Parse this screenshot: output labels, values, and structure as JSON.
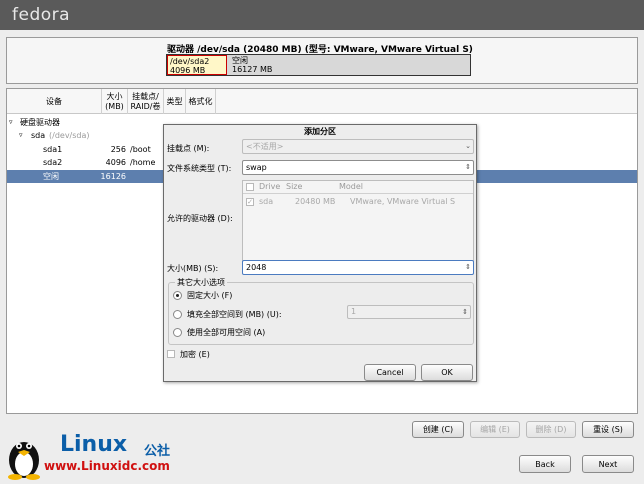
{
  "brand": {
    "logo_text": "fedora"
  },
  "drive": {
    "title": "驱动器 /dev/sda (20480 MB) (型号: VMware, VMware Virtual S)",
    "segments": [
      {
        "label": "/dev/sda2",
        "size": "4096 MB",
        "color": "#fff7c8"
      },
      {
        "label": "空闲",
        "size": "16127 MB"
      }
    ]
  },
  "table": {
    "headers": [
      "设备",
      "大小\n(MB)",
      "挂载点/\nRAID/卷",
      "类型",
      "格式化"
    ],
    "rows": [
      {
        "device": "硬盘驱动器",
        "size": "",
        "mount": "",
        "level": 0,
        "expander": "▿"
      },
      {
        "device": "sda",
        "device_path": "(/dev/sda)",
        "size": "",
        "mount": "",
        "level": 1,
        "expander": "▿"
      },
      {
        "device": "sda1",
        "size": "256",
        "mount": "/boot",
        "level": 2
      },
      {
        "device": "sda2",
        "size": "4096",
        "mount": "/home",
        "level": 2
      },
      {
        "device": "空闲",
        "size": "16126",
        "mount": "",
        "level": 2,
        "selected": true
      }
    ]
  },
  "dialog": {
    "title": "添加分区",
    "mount_label": "挂载点 (M):",
    "mount_value": "<不适用>",
    "fs_label": "文件系统类型 (T):",
    "fs_value": "swap",
    "drives_label": "允许的驱动器 (D):",
    "drive_columns": [
      "Drive",
      "Size",
      "Model"
    ],
    "drive_rows": [
      {
        "checked": true,
        "drive": "sda",
        "size": "20480 MB",
        "model": "VMware, VMware Virtual S"
      }
    ],
    "size_label": "大小(MB) (S):",
    "size_value": "2048",
    "options_title": "其它大小选项",
    "opt_fixed": "固定大小 (F)",
    "opt_fill_to": "填充全部空间到 (MB) (U):",
    "opt_fill_value": "1",
    "opt_fill_all": "使用全部可用空间 (A)",
    "selected_option": "fixed",
    "encrypt_label": "加密 (E)",
    "cancel_label": "Cancel",
    "ok_label": "OK"
  },
  "actions": {
    "create": "创建 (C)",
    "edit": "编辑 (E)",
    "delete": "删除 (D)",
    "reset": "重设 (S)"
  },
  "nav": {
    "back": "Back",
    "next": "Next"
  },
  "watermark": {
    "brand": "Linux",
    "suffix": "公社",
    "url": "www.Linuxidc.com"
  },
  "colors": {
    "selection": "#5d7fae",
    "topbar": "#5a5a5a",
    "watermark_blue": "#0b5ea8",
    "watermark_red": "#d01010"
  }
}
